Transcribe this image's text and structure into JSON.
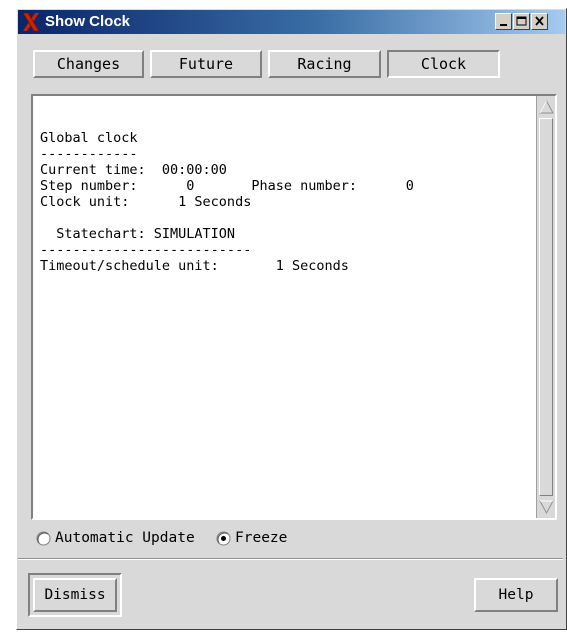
{
  "window": {
    "title": "Show Clock",
    "title_icon": "x-logo-icon",
    "controls": [
      "minimize-icon",
      "maximize-icon",
      "close-icon"
    ]
  },
  "tabs": [
    {
      "label": "Changes",
      "active": false
    },
    {
      "label": "Future",
      "active": false
    },
    {
      "label": "Racing",
      "active": false
    },
    {
      "label": "Clock",
      "active": true
    }
  ],
  "content": {
    "text": "Global clock\n------------\nCurrent time:  00:00:00\nStep number:      0       Phase number:      0\nClock unit:      1 Seconds\n\n  Statechart: SIMULATION\n--------------------------\nTimeout/schedule unit:       1 Seconds"
  },
  "radio": {
    "automatic_label": "Automatic Update",
    "freeze_label": "Freeze",
    "selected": "Freeze"
  },
  "buttons": {
    "dismiss_label": "Dismiss",
    "help_label": "Help"
  },
  "colors": {
    "titlebar_start": "#0a246a",
    "titlebar_end": "#a6caf0",
    "panel": "#d9d9d9",
    "x_logo": "#cc2200"
  }
}
